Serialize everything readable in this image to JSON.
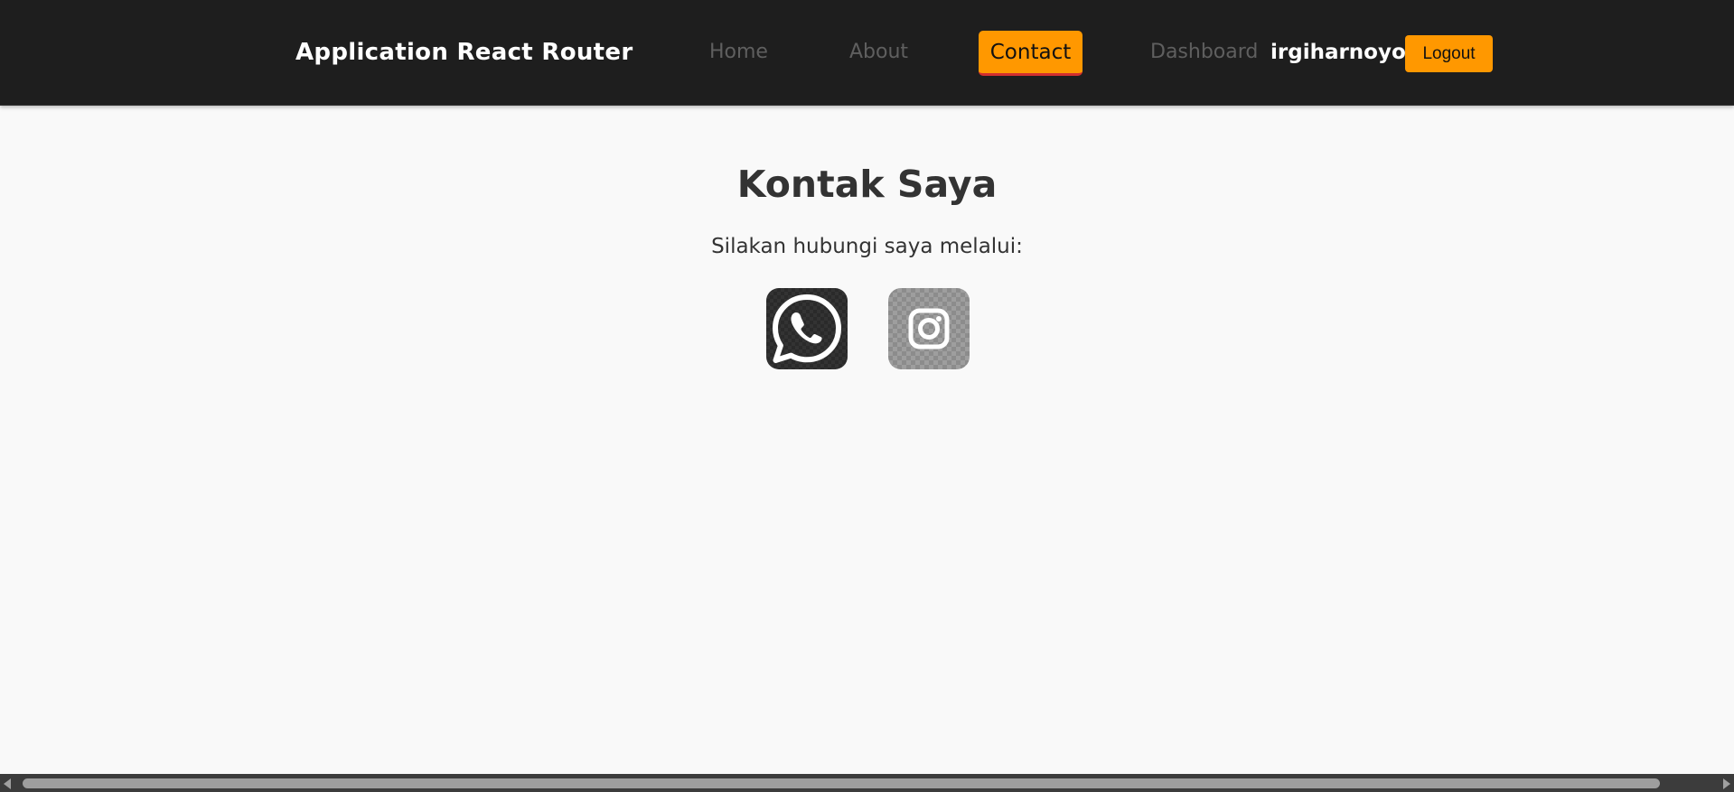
{
  "navbar": {
    "brand": "Application React Router",
    "links": {
      "home": "Home",
      "about": "About",
      "contact": "Contact",
      "dashboard": "Dashboard"
    },
    "active_link": "contact",
    "username": "irgiharnoyo",
    "logout_label": "Logout"
  },
  "main": {
    "title": "Kontak Saya",
    "subtitle": "Silakan hubungi saya melalui:",
    "social_links": [
      {
        "icon": "whatsapp-icon"
      },
      {
        "icon": "instagram-icon"
      }
    ]
  },
  "colors": {
    "navbar_bg": "#1e1e1e",
    "accent": "#ff9800",
    "active_underline": "#d32f2f",
    "page_bg": "#f9f9f9",
    "text": "#333333"
  }
}
